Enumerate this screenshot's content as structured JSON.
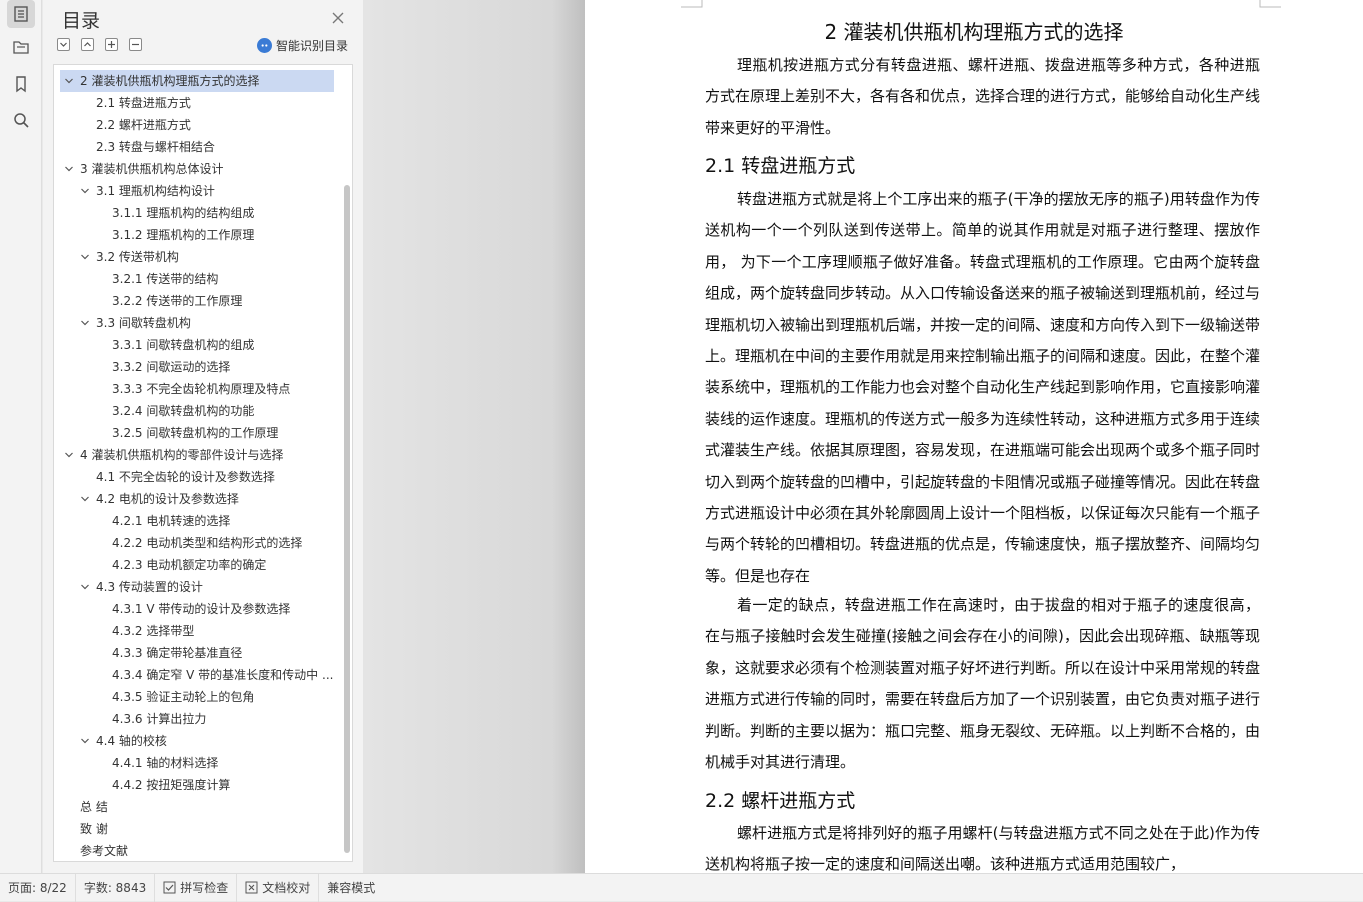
{
  "rail": {
    "icons": [
      "toc-icon",
      "folder-tree-icon",
      "bookmark-icon",
      "search-icon"
    ]
  },
  "toc": {
    "title": "目录",
    "smart_label": "智能识别目录",
    "items": [
      {
        "label": "2 灌装机供瓶机构理瓶方式的选择",
        "level": 1,
        "expanded": true,
        "selected": true
      },
      {
        "label": "2.1 转盘进瓶方式",
        "level": 2
      },
      {
        "label": "2.2 螺杆进瓶方式",
        "level": 2
      },
      {
        "label": "2.3 转盘与螺杆相结合",
        "level": 2
      },
      {
        "label": "3 灌装机供瓶机构总体设计",
        "level": 1,
        "expanded": true
      },
      {
        "label": "3.1 理瓶机构结构设计",
        "level": 2,
        "expanded": true
      },
      {
        "label": "3.1.1 理瓶机构的结构组成",
        "level": 3
      },
      {
        "label": "3.1.2 理瓶机构的工作原理",
        "level": 3
      },
      {
        "label": "3.2 传送带机构",
        "level": 2,
        "expanded": true
      },
      {
        "label": "3.2.1 传送带的结构",
        "level": 3
      },
      {
        "label": "3.2.2 传送带的工作原理",
        "level": 3
      },
      {
        "label": "3.3  间歇转盘机构",
        "level": 2,
        "expanded": true
      },
      {
        "label": "3.3.1 间歇转盘机构的组成",
        "level": 3
      },
      {
        "label": "3.3.2 间歇运动的选择",
        "level": 3
      },
      {
        "label": "3.3.3 不完全齿轮机构原理及特点",
        "level": 3
      },
      {
        "label": "3.2.4 间歇转盘机构的功能",
        "level": 3
      },
      {
        "label": "3.2.5  间歇转盘机构的工作原理",
        "level": 3
      },
      {
        "label": "4 灌装机供瓶机构的零部件设计与选择",
        "level": 1,
        "expanded": true
      },
      {
        "label": "4.1 不完全齿轮的设计及参数选择",
        "level": 2
      },
      {
        "label": "4.2 电机的设计及参数选择",
        "level": 2,
        "expanded": true
      },
      {
        "label": "4.2.1  电机转速的选择",
        "level": 3
      },
      {
        "label": "4.2.2 电动机类型和结构形式的选择",
        "level": 3
      },
      {
        "label": "4.2.3 电动机额定功率的确定",
        "level": 3
      },
      {
        "label": "4.3 传动装置的设计",
        "level": 2,
        "expanded": true
      },
      {
        "label": "4.3.1 V 带传动的设计及参数选择",
        "level": 3
      },
      {
        "label": "4.3.2 选择带型",
        "level": 3
      },
      {
        "label": "4.3.3 确定带轮基准直径",
        "level": 3
      },
      {
        "label": "4.3.4 确定窄 V 带的基准长度和传动中 ...",
        "level": 3
      },
      {
        "label": "4.3.5 验证主动轮上的包角",
        "level": 3
      },
      {
        "label": "4.3.6 计算出拉力",
        "level": 3
      },
      {
        "label": "4.4 轴的校核",
        "level": 2,
        "expanded": true
      },
      {
        "label": "4.4.1  轴的材料选择",
        "level": 3
      },
      {
        "label": "4.4.2 按扭矩强度计算",
        "level": 3
      },
      {
        "label": "总    结",
        "level": 1
      },
      {
        "label": "致    谢",
        "level": 1
      },
      {
        "label": "参考文献",
        "level": 1
      }
    ]
  },
  "document": {
    "title": "2 灌装机供瓶机构理瓶方式的选择",
    "intro": "理瓶机按进瓶方式分有转盘进瓶、螺杆进瓶、拨盘进瓶等多种方式，各种进瓶方式在原理上差别不大，各有各和优点，选择合理的进行方式，能够给自动化生产线带来更好的平滑性。",
    "h21": "2.1 转盘进瓶方式",
    "p21a": "转盘进瓶方式就是将上个工序出来的瓶子(干净的摆放无序的瓶子)用转盘作为传送机构一个一个列队送到传送带上。简单的说其作用就是对瓶子进行整理、摆放作用，  为下一个工序理顺瓶子做好准备。转盘式理瓶机的工作原理。它由两个旋转盘组成，两个旋转盘同步转动。从入口传输设备送来的瓶子被输送到理瓶机前，经过与理瓶机切入被输出到理瓶机后端，并按一定的间隔、速度和方向传入到下一级输送带上。理瓶机在中间的主要作用就是用来控制输出瓶子的间隔和速度。因此，在整个灌装系统中，理瓶机的工作能力也会对整个自动化生产线起到影响作用，它直接影响灌装线的运作速度。理瓶机的传送方式一般多为连续性转动，这种进瓶方式多用于连续式灌装生产线。依据其原理图，容易发现，在进瓶端可能会出现两个或多个瓶子同时切入到两个旋转盘的凹槽中，引起旋转盘的卡阻情况或瓶子碰撞等情况。因此在转盘方式进瓶设计中必须在其外轮廓圆周上设计一个阻档板，以保证每次只能有一个瓶子与两个转轮的凹槽相切。转盘进瓶的优点是，传输速度快，瓶子摆放整齐、间隔均匀等。但是也存在",
    "p21b": "着一定的缺点，转盘进瓶工作在高速时，由于拔盘的相对于瓶子的速度很高，在与瓶子接触时会发生碰撞(接触之间会存在小的间隙)，因此会出现碎瓶、缺瓶等现象，这就要求必须有个检测装置对瓶子好坏进行判断。所以在设计中采用常规的转盘进瓶方式进行传输的同时，需要在转盘后方加了一个识别装置，由它负责对瓶子进行判断。判断的主要以据为：瓶口完整、瓶身无裂纹、无碎瓶。以上判断不合格的，由机械手对其进行清理。",
    "h22": "2.2 螺杆进瓶方式",
    "p22": "螺杆进瓶方式是将排列好的瓶子用螺杆(与转盘进瓶方式不同之处在于此)作为传送机构将瓶子按一定的速度和间隔送出嘲。该种进瓶方式适用范围较广，"
  },
  "status": {
    "page": "页面: 8/22",
    "words": "字数: 8843",
    "spell": "拼写检查",
    "proof": "文档校对",
    "compat": "兼容模式"
  }
}
